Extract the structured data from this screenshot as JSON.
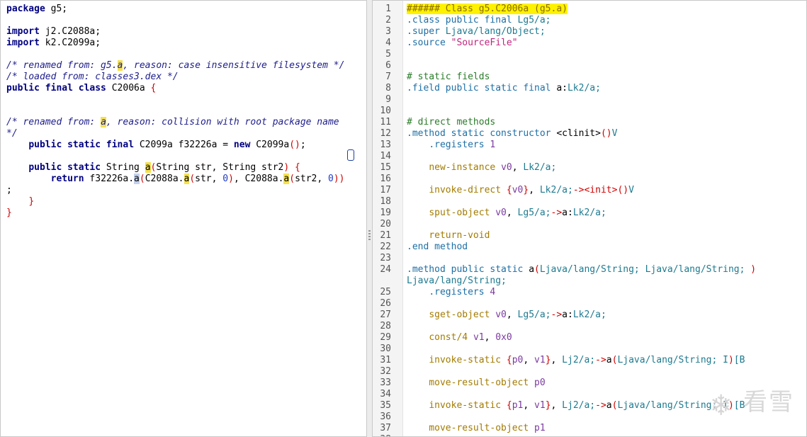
{
  "left": {
    "lines": [
      {
        "t": [
          {
            "c": "kw",
            "v": "package"
          },
          {
            "c": "",
            "v": " g5;"
          }
        ]
      },
      {
        "t": []
      },
      {
        "t": [
          {
            "c": "kw",
            "v": "import"
          },
          {
            "c": "",
            "v": " j2.C2088a;"
          }
        ]
      },
      {
        "t": [
          {
            "c": "kw",
            "v": "import"
          },
          {
            "c": "",
            "v": " k2.C2099a;"
          }
        ]
      },
      {
        "t": []
      },
      {
        "t": [
          {
            "c": "cm",
            "v": "/* renamed from: g5."
          },
          {
            "c": "cm hl",
            "v": "a"
          },
          {
            "c": "cm",
            "v": ", reason: case insensitive filesystem */"
          }
        ]
      },
      {
        "t": [
          {
            "c": "cm",
            "v": "/* loaded from: classes3.dex */"
          }
        ]
      },
      {
        "t": [
          {
            "c": "kw",
            "v": "public final class"
          },
          {
            "c": "",
            "v": " C2006a "
          },
          {
            "c": "red",
            "v": "{"
          }
        ]
      },
      {
        "t": []
      },
      {
        "t": []
      },
      {
        "t": [
          {
            "c": "cm",
            "v": "/* renamed from: "
          },
          {
            "c": "cm hl",
            "v": "a"
          },
          {
            "c": "cm",
            "v": ", reason: collision with root package name"
          }
        ]
      },
      {
        "t": [
          {
            "c": "cm",
            "v": "*/"
          }
        ]
      },
      {
        "t": [
          {
            "c": "",
            "v": "    "
          },
          {
            "c": "kw",
            "v": "public static final"
          },
          {
            "c": "",
            "v": " C2099a f32226a = "
          },
          {
            "c": "kw",
            "v": "new"
          },
          {
            "c": "",
            "v": " C2099a"
          },
          {
            "c": "red",
            "v": "()"
          },
          {
            "c": "",
            "v": ";"
          }
        ]
      },
      {
        "t": []
      },
      {
        "t": [
          {
            "c": "",
            "v": "    "
          },
          {
            "c": "kw",
            "v": "public static"
          },
          {
            "c": "",
            "v": " String "
          },
          {
            "c": "hl",
            "v": "a"
          },
          {
            "c": "red",
            "v": "("
          },
          {
            "c": "",
            "v": "String str, String str2"
          },
          {
            "c": "red",
            "v": ")"
          },
          {
            "c": "",
            "v": " "
          },
          {
            "c": "red",
            "v": "{"
          }
        ]
      },
      {
        "t": [
          {
            "c": "",
            "v": "        "
          },
          {
            "c": "kw",
            "v": "return"
          },
          {
            "c": "",
            "v": " f32226a."
          },
          {
            "c": "hlg",
            "v": "a"
          },
          {
            "c": "red",
            "v": "("
          },
          {
            "c": "",
            "v": "C2088a."
          },
          {
            "c": "hl",
            "v": "a"
          },
          {
            "c": "red",
            "v": "("
          },
          {
            "c": "",
            "v": "str, "
          },
          {
            "c": "num",
            "v": "0"
          },
          {
            "c": "red",
            "v": ")"
          },
          {
            "c": "",
            "v": ", C2088a."
          },
          {
            "c": "hl",
            "v": "a"
          },
          {
            "c": "red",
            "v": "("
          },
          {
            "c": "",
            "v": "str2, "
          },
          {
            "c": "num",
            "v": "0"
          },
          {
            "c": "red",
            "v": "))"
          }
        ]
      },
      {
        "t": [
          {
            "c": "",
            "v": ";"
          }
        ]
      },
      {
        "t": [
          {
            "c": "",
            "v": "    "
          },
          {
            "c": "red",
            "v": "}"
          }
        ]
      },
      {
        "t": [
          {
            "c": "red",
            "v": "}"
          }
        ]
      }
    ]
  },
  "right": {
    "rows": [
      {
        "n": "1",
        "t": [
          {
            "c": "title-hl",
            "v": "###### Class g5.C2006a (g5.a)"
          }
        ]
      },
      {
        "n": "2",
        "t": [
          {
            "c": "sm-dir",
            "v": ".class"
          },
          {
            "c": "",
            "v": " "
          },
          {
            "c": "sm-dir",
            "v": "public final"
          },
          {
            "c": "",
            "v": " "
          },
          {
            "c": "sm-type",
            "v": "Lg5/a;"
          }
        ]
      },
      {
        "n": "3",
        "t": [
          {
            "c": "sm-dir",
            "v": ".super"
          },
          {
            "c": "",
            "v": " "
          },
          {
            "c": "sm-type",
            "v": "Ljava/lang/Object;"
          }
        ]
      },
      {
        "n": "4",
        "t": [
          {
            "c": "sm-dir",
            "v": ".source"
          },
          {
            "c": "",
            "v": " "
          },
          {
            "c": "sm-str",
            "v": "\"SourceFile\""
          }
        ]
      },
      {
        "n": "5",
        "t": []
      },
      {
        "n": "6",
        "t": []
      },
      {
        "n": "7",
        "t": [
          {
            "c": "sm-cmt",
            "v": "# static fields"
          }
        ]
      },
      {
        "n": "8",
        "t": [
          {
            "c": "sm-dir",
            "v": ".field public static final"
          },
          {
            "c": "",
            "v": " a:"
          },
          {
            "c": "sm-type",
            "v": "Lk2/a;"
          }
        ]
      },
      {
        "n": "9",
        "t": []
      },
      {
        "n": "10",
        "t": []
      },
      {
        "n": "11",
        "t": [
          {
            "c": "sm-cmt",
            "v": "# direct methods"
          }
        ]
      },
      {
        "n": "12",
        "t": [
          {
            "c": "sm-dir",
            "v": ".method static constructor"
          },
          {
            "c": "",
            "v": " <clinit>"
          },
          {
            "c": "red",
            "v": "()"
          },
          {
            "c": "sm-type",
            "v": "V"
          }
        ]
      },
      {
        "n": "13",
        "t": [
          {
            "c": "",
            "v": "    "
          },
          {
            "c": "sm-dir",
            "v": ".registers"
          },
          {
            "c": "",
            "v": " "
          },
          {
            "c": "sm-num",
            "v": "1"
          }
        ]
      },
      {
        "n": "14",
        "t": []
      },
      {
        "n": "15",
        "t": [
          {
            "c": "",
            "v": "    "
          },
          {
            "c": "sm-ins",
            "v": "new-instance"
          },
          {
            "c": "",
            "v": " "
          },
          {
            "c": "sm-reg",
            "v": "v0"
          },
          {
            "c": "",
            "v": ", "
          },
          {
            "c": "sm-type",
            "v": "Lk2/a;"
          }
        ]
      },
      {
        "n": "16",
        "t": []
      },
      {
        "n": "17",
        "t": [
          {
            "c": "",
            "v": "    "
          },
          {
            "c": "sm-ins",
            "v": "invoke-direct"
          },
          {
            "c": "",
            "v": " "
          },
          {
            "c": "red",
            "v": "{"
          },
          {
            "c": "sm-reg",
            "v": "v0"
          },
          {
            "c": "red",
            "v": "}"
          },
          {
            "c": "",
            "v": ", "
          },
          {
            "c": "sm-type",
            "v": "Lk2/a;"
          },
          {
            "c": "sm-arrow",
            "v": "-><init>()"
          },
          {
            "c": "sm-type",
            "v": "V"
          }
        ]
      },
      {
        "n": "18",
        "t": []
      },
      {
        "n": "19",
        "t": [
          {
            "c": "",
            "v": "    "
          },
          {
            "c": "sm-ins",
            "v": "sput-object"
          },
          {
            "c": "",
            "v": " "
          },
          {
            "c": "sm-reg",
            "v": "v0"
          },
          {
            "c": "",
            "v": ", "
          },
          {
            "c": "sm-type",
            "v": "Lg5/a;"
          },
          {
            "c": "sm-arrow",
            "v": "->"
          },
          {
            "c": "",
            "v": "a:"
          },
          {
            "c": "sm-type",
            "v": "Lk2/a;"
          }
        ]
      },
      {
        "n": "20",
        "t": []
      },
      {
        "n": "21",
        "t": [
          {
            "c": "",
            "v": "    "
          },
          {
            "c": "sm-ins",
            "v": "return-void"
          }
        ]
      },
      {
        "n": "22",
        "t": [
          {
            "c": "sm-dir",
            "v": ".end method"
          }
        ]
      },
      {
        "n": "23",
        "t": []
      },
      {
        "n": "24",
        "t": [
          {
            "c": "sm-dir",
            "v": ".method public static"
          },
          {
            "c": "",
            "v": " a"
          },
          {
            "c": "red",
            "v": "("
          },
          {
            "c": "sm-type",
            "v": "Ljava/lang/String; Ljava/lang/String;"
          },
          {
            "c": "",
            "v": " "
          },
          {
            "c": "red",
            "v": ")"
          }
        ]
      },
      {
        "n": "",
        "t": [
          {
            "c": "sm-type",
            "v": "Ljava/lang/String;"
          }
        ]
      },
      {
        "n": "25",
        "t": [
          {
            "c": "",
            "v": "    "
          },
          {
            "c": "sm-dir",
            "v": ".registers"
          },
          {
            "c": "",
            "v": " "
          },
          {
            "c": "sm-num",
            "v": "4"
          }
        ]
      },
      {
        "n": "26",
        "t": []
      },
      {
        "n": "27",
        "t": [
          {
            "c": "",
            "v": "    "
          },
          {
            "c": "sm-ins",
            "v": "sget-object"
          },
          {
            "c": "",
            "v": " "
          },
          {
            "c": "sm-reg",
            "v": "v0"
          },
          {
            "c": "",
            "v": ", "
          },
          {
            "c": "sm-type",
            "v": "Lg5/a;"
          },
          {
            "c": "sm-arrow",
            "v": "->"
          },
          {
            "c": "",
            "v": "a:"
          },
          {
            "c": "sm-type",
            "v": "Lk2/a;"
          }
        ]
      },
      {
        "n": "28",
        "t": []
      },
      {
        "n": "29",
        "t": [
          {
            "c": "",
            "v": "    "
          },
          {
            "c": "sm-ins",
            "v": "const/4"
          },
          {
            "c": "",
            "v": " "
          },
          {
            "c": "sm-reg",
            "v": "v1"
          },
          {
            "c": "",
            "v": ", "
          },
          {
            "c": "sm-num",
            "v": "0x0"
          }
        ]
      },
      {
        "n": "30",
        "t": []
      },
      {
        "n": "31",
        "t": [
          {
            "c": "",
            "v": "    "
          },
          {
            "c": "sm-ins",
            "v": "invoke-static"
          },
          {
            "c": "",
            "v": " "
          },
          {
            "c": "red",
            "v": "{"
          },
          {
            "c": "sm-reg",
            "v": "p0"
          },
          {
            "c": "",
            "v": ", "
          },
          {
            "c": "sm-reg",
            "v": "v1"
          },
          {
            "c": "red",
            "v": "}"
          },
          {
            "c": "",
            "v": ", "
          },
          {
            "c": "sm-type",
            "v": "Lj2/a;"
          },
          {
            "c": "sm-arrow",
            "v": "->"
          },
          {
            "c": "",
            "v": "a"
          },
          {
            "c": "red",
            "v": "("
          },
          {
            "c": "sm-type",
            "v": "Ljava/lang/String; I"
          },
          {
            "c": "red",
            "v": ")"
          },
          {
            "c": "sm-type",
            "v": "[B"
          }
        ]
      },
      {
        "n": "32",
        "t": []
      },
      {
        "n": "33",
        "t": [
          {
            "c": "",
            "v": "    "
          },
          {
            "c": "sm-ins",
            "v": "move-result-object"
          },
          {
            "c": "",
            "v": " "
          },
          {
            "c": "sm-reg",
            "v": "p0"
          }
        ]
      },
      {
        "n": "34",
        "t": []
      },
      {
        "n": "35",
        "t": [
          {
            "c": "",
            "v": "    "
          },
          {
            "c": "sm-ins",
            "v": "invoke-static"
          },
          {
            "c": "",
            "v": " "
          },
          {
            "c": "red",
            "v": "{"
          },
          {
            "c": "sm-reg",
            "v": "p1"
          },
          {
            "c": "",
            "v": ", "
          },
          {
            "c": "sm-reg",
            "v": "v1"
          },
          {
            "c": "red",
            "v": "}"
          },
          {
            "c": "",
            "v": ", "
          },
          {
            "c": "sm-type",
            "v": "Lj2/a;"
          },
          {
            "c": "sm-arrow",
            "v": "->"
          },
          {
            "c": "",
            "v": "a"
          },
          {
            "c": "red",
            "v": "("
          },
          {
            "c": "sm-type",
            "v": "Ljava/lang/String; I"
          },
          {
            "c": "red",
            "v": ")"
          },
          {
            "c": "sm-type",
            "v": "[B"
          }
        ]
      },
      {
        "n": "36",
        "t": []
      },
      {
        "n": "37",
        "t": [
          {
            "c": "",
            "v": "    "
          },
          {
            "c": "sm-ins",
            "v": "move-result-object"
          },
          {
            "c": "",
            "v": " "
          },
          {
            "c": "sm-reg",
            "v": "p1"
          }
        ]
      },
      {
        "n": "38",
        "t": []
      }
    ]
  },
  "watermark": {
    "text": "看雪",
    "icon": "snowflake-icon"
  }
}
